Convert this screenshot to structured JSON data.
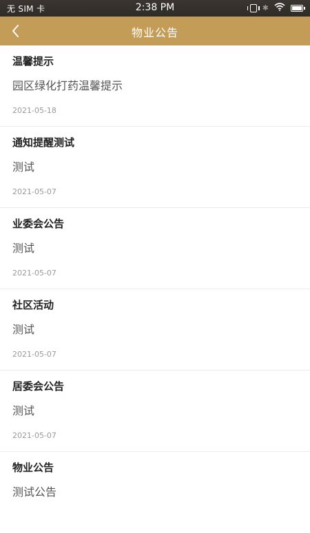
{
  "status_bar": {
    "carrier": "无 SIM 卡",
    "time": "2:38 PM"
  },
  "header": {
    "title": "物业公告"
  },
  "notices": [
    {
      "title": "温馨提示",
      "content": "园区绿化打药温馨提示",
      "date": "2021-05-18"
    },
    {
      "title": "通知提醒测试",
      "content": "测试",
      "date": "2021-05-07"
    },
    {
      "title": "业委会公告",
      "content": "测试",
      "date": "2021-05-07"
    },
    {
      "title": "社区活动",
      "content": "测试",
      "date": "2021-05-07"
    },
    {
      "title": "居委会公告",
      "content": "测试",
      "date": "2021-05-07"
    },
    {
      "title": "物业公告",
      "content": "测试公告",
      "date": ""
    }
  ],
  "colors": {
    "accent": "#c39c57",
    "status_bar": "#2f2b27"
  }
}
